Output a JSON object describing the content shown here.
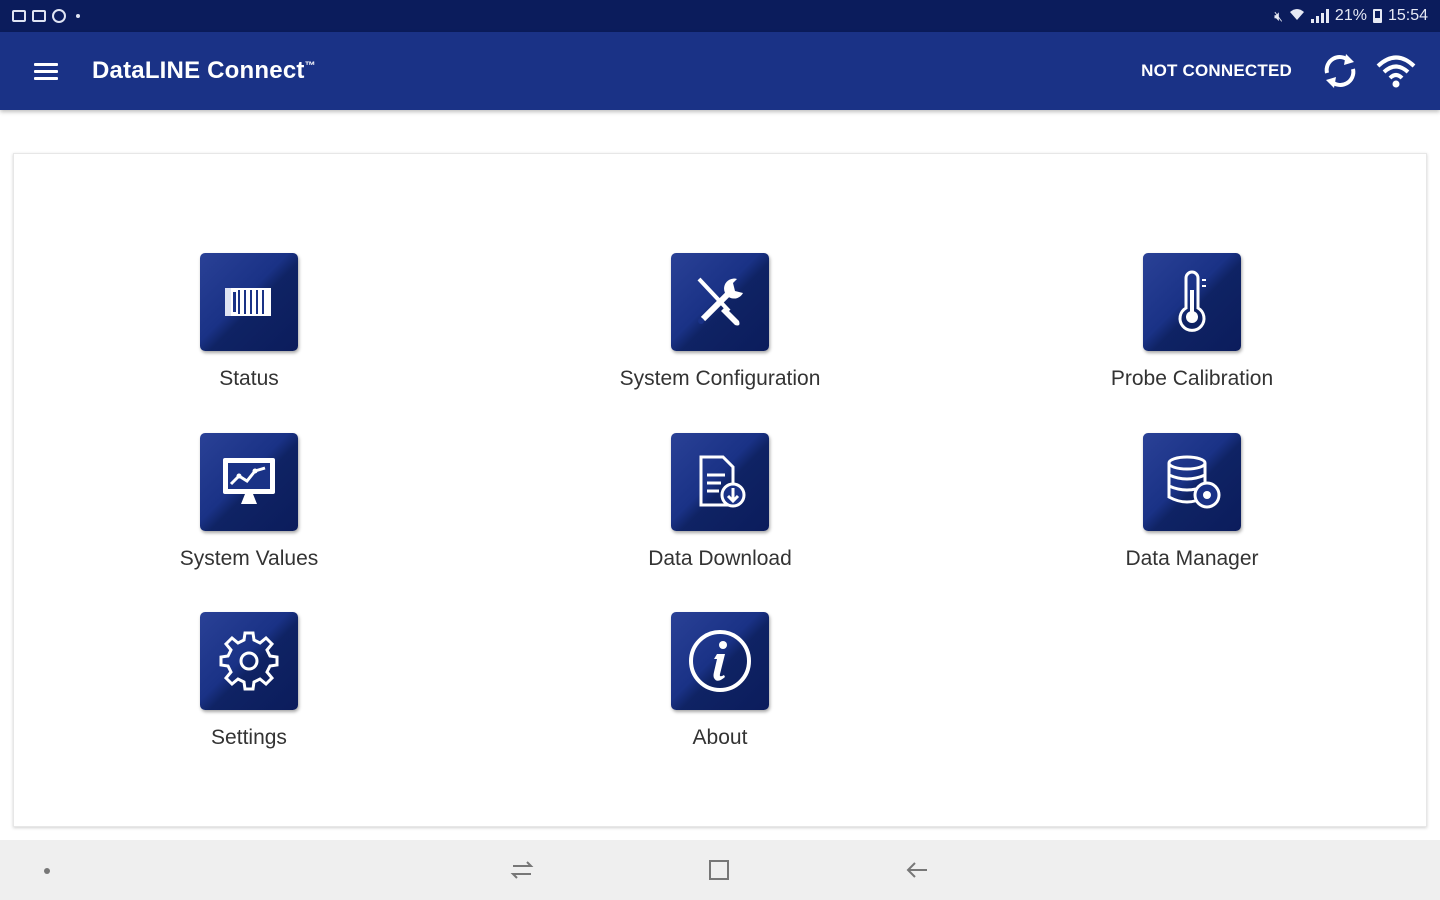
{
  "status_bar": {
    "battery": "21%",
    "time": "15:54"
  },
  "app_bar": {
    "title": "DataLINE Connect",
    "trademark": "™",
    "connection_status": "NOT CONNECTED"
  },
  "tiles": [
    {
      "label": "Status",
      "icon": "container-icon"
    },
    {
      "label": "System Configuration",
      "icon": "tools-icon"
    },
    {
      "label": "Probe Calibration",
      "icon": "thermometer-icon"
    },
    {
      "label": "System Values",
      "icon": "monitor-chart-icon"
    },
    {
      "label": "Data Download",
      "icon": "document-download-icon"
    },
    {
      "label": "Data Manager",
      "icon": "database-gear-icon"
    },
    {
      "label": "Settings",
      "icon": "gear-icon"
    },
    {
      "label": "About",
      "icon": "info-icon"
    }
  ],
  "colors": {
    "status_bar": "#0b1c5c",
    "app_bar": "#1a3286",
    "tile": "#1a3286",
    "label_text": "#333333",
    "nav_bar": "#efefef"
  }
}
